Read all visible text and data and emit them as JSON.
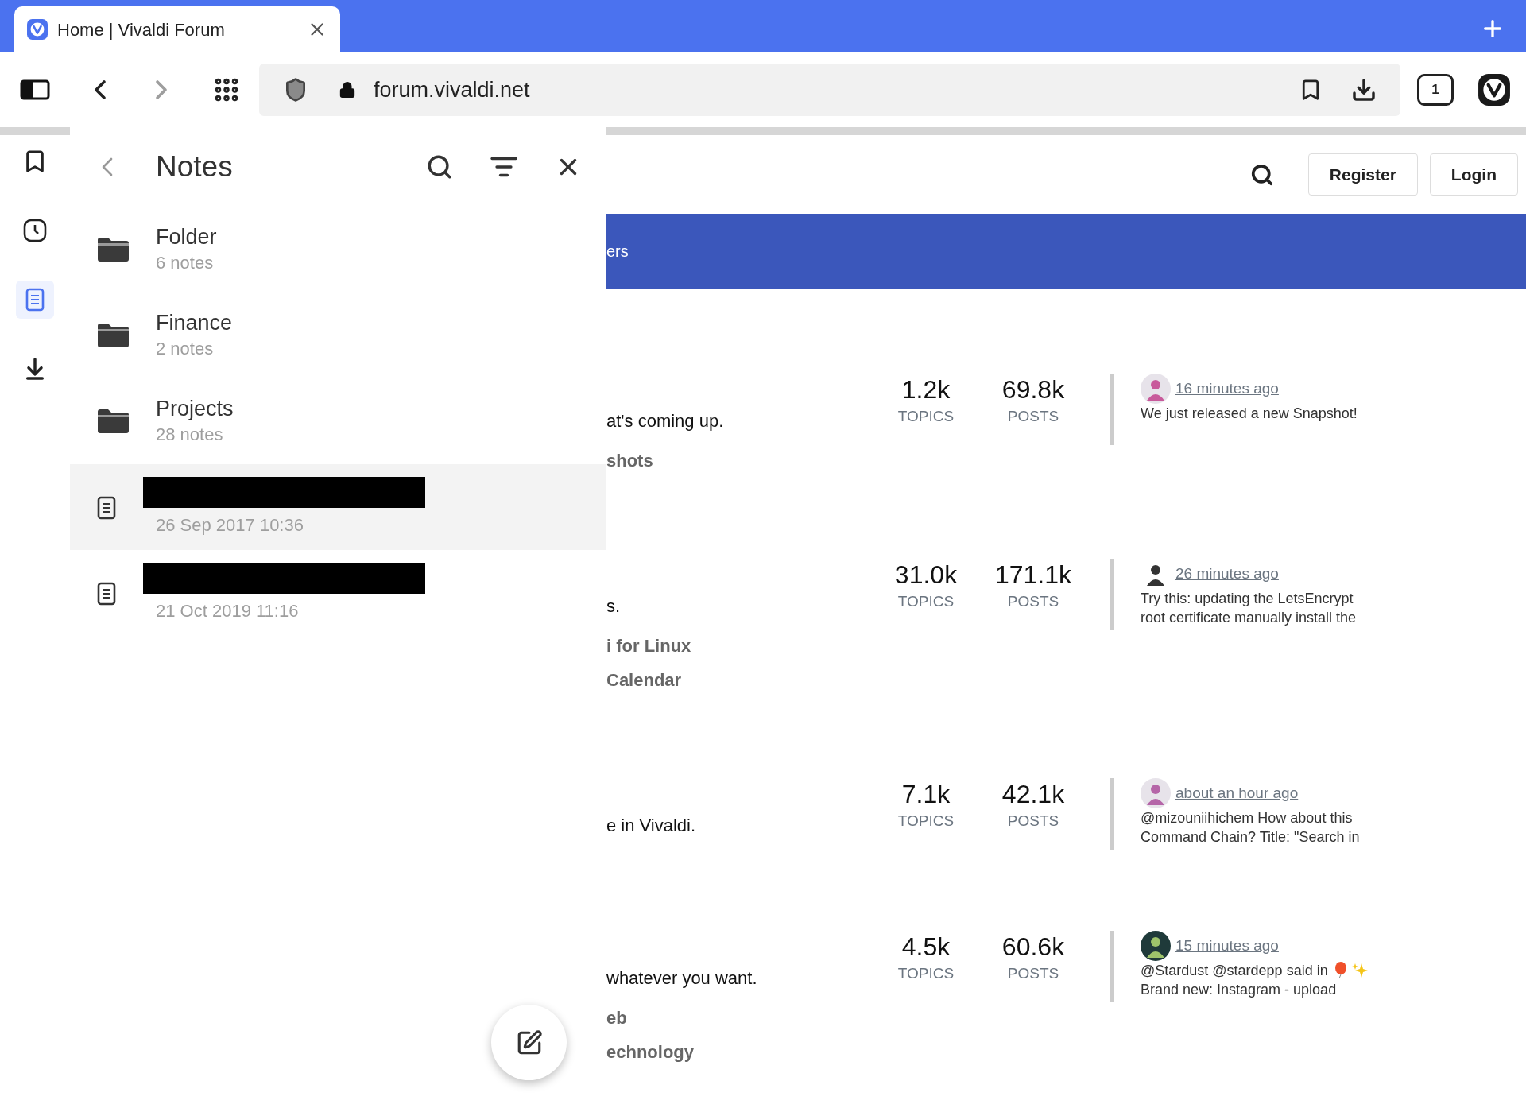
{
  "tab": {
    "title": "Home | Vivaldi Forum"
  },
  "toolbar": {
    "forward_disabled": true,
    "url": "forum.vivaldi.net",
    "tab_count": "1"
  },
  "side_panels": [
    {
      "selected": false
    },
    {
      "selected": false
    },
    {
      "selected": true
    },
    {
      "selected": false
    }
  ],
  "notes_panel": {
    "title": "Notes",
    "folders": [
      {
        "name": "Folder",
        "count": "6 notes"
      },
      {
        "name": "Finance",
        "count": "2 notes"
      },
      {
        "name": "Projects",
        "count": "28 notes"
      }
    ],
    "notes": [
      {
        "date": "26 Sep 2017 10:36",
        "selected": true
      },
      {
        "date": "21 Oct 2019 11:16",
        "selected": false
      }
    ]
  },
  "forum": {
    "buttons": [
      "Register",
      "Login"
    ],
    "banner_text": "ers",
    "categories": [
      {
        "description": "at's coming up.",
        "subcategories": [
          "shots"
        ],
        "topics": "1.2k",
        "topics_label": "TOPICS",
        "posts": "69.8k",
        "posts_label": "POSTS",
        "last_post": {
          "time": "16 minutes ago",
          "lines": [
            "We just released a new Snapshot!"
          ],
          "emoji": false
        }
      },
      {
        "description": "s.",
        "subcategories": [
          "i for Linux",
          "Calendar"
        ],
        "topics": "31.0k",
        "topics_label": "TOPICS",
        "posts": "171.1k",
        "posts_label": "POSTS",
        "last_post": {
          "time": "26 minutes ago",
          "lines": [
            "Try this: updating the LetsEncrypt",
            "root certificate manually install the"
          ],
          "emoji": false
        }
      },
      {
        "description": "e in Vivaldi.",
        "topics": "7.1k",
        "topics_label": "TOPICS",
        "posts": "42.1k",
        "posts_label": "POSTS",
        "last_post": {
          "time": "about an hour ago",
          "lines": [
            "@mizouniihichem How about this",
            "Command Chain? Title: \"Search in"
          ],
          "emoji": false
        }
      },
      {
        "description": "whatever you want.",
        "subcategories": [
          "eb",
          "echnology"
        ],
        "topics": "4.5k",
        "topics_label": "TOPICS",
        "posts": "60.6k",
        "posts_label": "POSTS",
        "last_post": {
          "time": "15 minutes ago",
          "lines": [
            "@Stardust @stardepp said in",
            "Brand new: Instagram - upload"
          ],
          "emoji": true
        }
      }
    ]
  }
}
